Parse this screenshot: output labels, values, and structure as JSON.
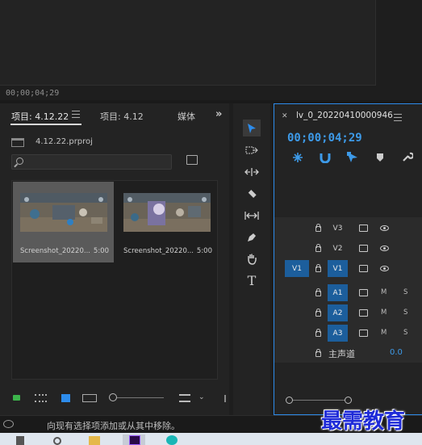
{
  "source_monitor": {
    "timecode": "00;00;04;29"
  },
  "project_panel": {
    "tabs": [
      {
        "label": "项目: 4.12.22",
        "active": true
      },
      {
        "label": "项目: 4.12",
        "active": false
      },
      {
        "label": "媒体",
        "active": false
      }
    ],
    "overflow": "»",
    "project_file": "4.12.22.prproj",
    "search": {
      "value": "",
      "placeholder": ""
    },
    "clips": [
      {
        "name": "Screenshot_20220...",
        "duration": "5:00",
        "selected": true
      },
      {
        "name": "Screenshot_20220...",
        "duration": "5:00",
        "selected": false
      }
    ]
  },
  "timeline": {
    "sequence_name": "lv_0_20220410000946",
    "timecode": "00;00;04;29",
    "video_tracks": [
      "V3",
      "V2",
      "V1"
    ],
    "source_patch": "V1",
    "audio_tracks": [
      "A1",
      "A2",
      "A3"
    ],
    "mute_label": "M",
    "solo_label": "S",
    "master": {
      "label": "主声道",
      "value": "0.0"
    }
  },
  "status_bar": {
    "text": "向现有选择项添加或从其中移除。"
  },
  "watermark": "最需教育",
  "colors": {
    "accent": "#2d8ceb",
    "timecode": "#3d9ae8",
    "track_on": "#1c5e9c",
    "panel": "#232323",
    "watermark": "#1f2bd8"
  }
}
